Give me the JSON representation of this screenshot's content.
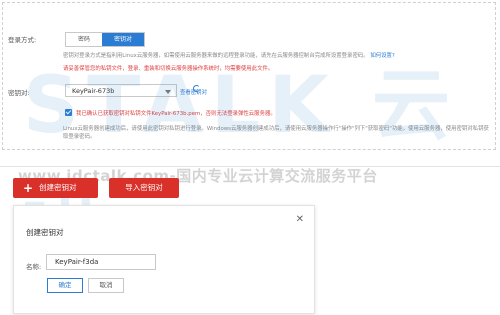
{
  "login": {
    "label": "登录方式:",
    "options": [
      "密码",
      "密钥对"
    ],
    "selected": "密钥对",
    "desc1": "密钥对登录方式是指利用Linux云服务器，如需使用云服务器来做的远程登录功能，请先在云服务器控制台完成所设置登录密码。",
    "desc1_link": "如何设置?",
    "warn": "请妥善保管您的私钥文件，登录、重装和切换云服务器操作系统时，均需要使用此文件。",
    "keypair_label": "密钥对:",
    "keypair_value": "KeyPair-673b",
    "keypair_link": "查看密钥对",
    "confirm_text": "我已确认已获取密钥对私钥文件KeyPair-673b.pem，否则无法登录弹性云服务器。",
    "note": "Linux云服务器创建成功后，请使用此密钥对私钥进行登录。Windows云服务器创建成功后，请使用云服务器操作行\"操作\"列下\"获取密码\"功能，使用云服务器，使用密钥对私钥获取登录密码。"
  },
  "watermark": {
    "logo": "STALK 云讯",
    "url_line": "www.idctalk.com-国内专业云计算交流服务平台"
  },
  "actions": {
    "create_label": "创建密钥对",
    "import_label": "导入密钥对"
  },
  "dialog": {
    "title": "创建密钥对",
    "name_label": "名称:",
    "name_value": "KeyPair-f3da",
    "ok_label": "确定",
    "cancel_label": "取消"
  },
  "colors": {
    "primary": "#2b7cd3",
    "danger": "#d9302a"
  }
}
